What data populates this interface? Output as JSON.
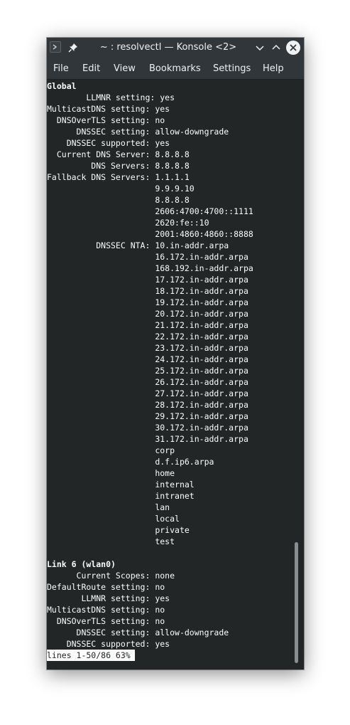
{
  "window": {
    "title": "~ : resolvectl — Konsole <2>"
  },
  "menu": [
    "File",
    "Edit",
    "View",
    "Bookmarks",
    "Settings",
    "Help"
  ],
  "terminal": {
    "lines": [
      {
        "k": "Global",
        "v": "",
        "bold": true
      },
      {
        "k": "        LLMNR setting:",
        "v": " yes"
      },
      {
        "k": "MulticastDNS setting:",
        "v": " yes"
      },
      {
        "k": "  DNSOverTLS setting:",
        "v": " no"
      },
      {
        "k": "      DNSSEC setting:",
        "v": " allow-downgrade"
      },
      {
        "k": "    DNSSEC supported:",
        "v": " yes"
      },
      {
        "k": "  Current DNS Server:",
        "v": " 8.8.8.8"
      },
      {
        "k": "         DNS Servers:",
        "v": " 8.8.8.8"
      },
      {
        "k": "Fallback DNS Servers:",
        "v": " 1.1.1.1"
      },
      {
        "k": "                     ",
        "v": " 9.9.9.10"
      },
      {
        "k": "                     ",
        "v": " 8.8.8.8"
      },
      {
        "k": "                     ",
        "v": " 2606:4700:4700::1111"
      },
      {
        "k": "                     ",
        "v": " 2620:fe::10"
      },
      {
        "k": "                     ",
        "v": " 2001:4860:4860::8888"
      },
      {
        "k": "          DNSSEC NTA:",
        "v": " 10.in-addr.arpa"
      },
      {
        "k": "                     ",
        "v": " 16.172.in-addr.arpa"
      },
      {
        "k": "                     ",
        "v": " 168.192.in-addr.arpa"
      },
      {
        "k": "                     ",
        "v": " 17.172.in-addr.arpa"
      },
      {
        "k": "                     ",
        "v": " 18.172.in-addr.arpa"
      },
      {
        "k": "                     ",
        "v": " 19.172.in-addr.arpa"
      },
      {
        "k": "                     ",
        "v": " 20.172.in-addr.arpa"
      },
      {
        "k": "                     ",
        "v": " 21.172.in-addr.arpa"
      },
      {
        "k": "                     ",
        "v": " 22.172.in-addr.arpa"
      },
      {
        "k": "                     ",
        "v": " 23.172.in-addr.arpa"
      },
      {
        "k": "                     ",
        "v": " 24.172.in-addr.arpa"
      },
      {
        "k": "                     ",
        "v": " 25.172.in-addr.arpa"
      },
      {
        "k": "                     ",
        "v": " 26.172.in-addr.arpa"
      },
      {
        "k": "                     ",
        "v": " 27.172.in-addr.arpa"
      },
      {
        "k": "                     ",
        "v": " 28.172.in-addr.arpa"
      },
      {
        "k": "                     ",
        "v": " 29.172.in-addr.arpa"
      },
      {
        "k": "                     ",
        "v": " 30.172.in-addr.arpa"
      },
      {
        "k": "                     ",
        "v": " 31.172.in-addr.arpa"
      },
      {
        "k": "                     ",
        "v": " corp"
      },
      {
        "k": "                     ",
        "v": " d.f.ip6.arpa"
      },
      {
        "k": "                     ",
        "v": " home"
      },
      {
        "k": "                     ",
        "v": " internal"
      },
      {
        "k": "                     ",
        "v": " intranet"
      },
      {
        "k": "                     ",
        "v": " lan"
      },
      {
        "k": "                     ",
        "v": " local"
      },
      {
        "k": "                     ",
        "v": " private"
      },
      {
        "k": "                     ",
        "v": " test"
      },
      {
        "k": "",
        "v": ""
      },
      {
        "k": "Link 6 (wlan0)",
        "v": "",
        "bold": true
      },
      {
        "k": "      Current Scopes:",
        "v": " none"
      },
      {
        "k": "DefaultRoute setting:",
        "v": " no"
      },
      {
        "k": "       LLMNR setting:",
        "v": " yes"
      },
      {
        "k": "MulticastDNS setting:",
        "v": " no"
      },
      {
        "k": "  DNSOverTLS setting:",
        "v": " no"
      },
      {
        "k": "      DNSSEC setting:",
        "v": " allow-downgrade"
      },
      {
        "k": "    DNSSEC supported:",
        "v": " yes"
      }
    ],
    "status_line": "lines 1-50/86 63%"
  },
  "icons": {
    "app": "terminal-icon",
    "pin": "pin-icon",
    "minimize": "chevron-down-icon",
    "maximize": "chevron-up-icon",
    "close": "close-icon"
  },
  "colors": {
    "terminal_bg": "#232627",
    "terminal_fg": "#fcfcfc",
    "titlebar_bg": "#31363b"
  }
}
